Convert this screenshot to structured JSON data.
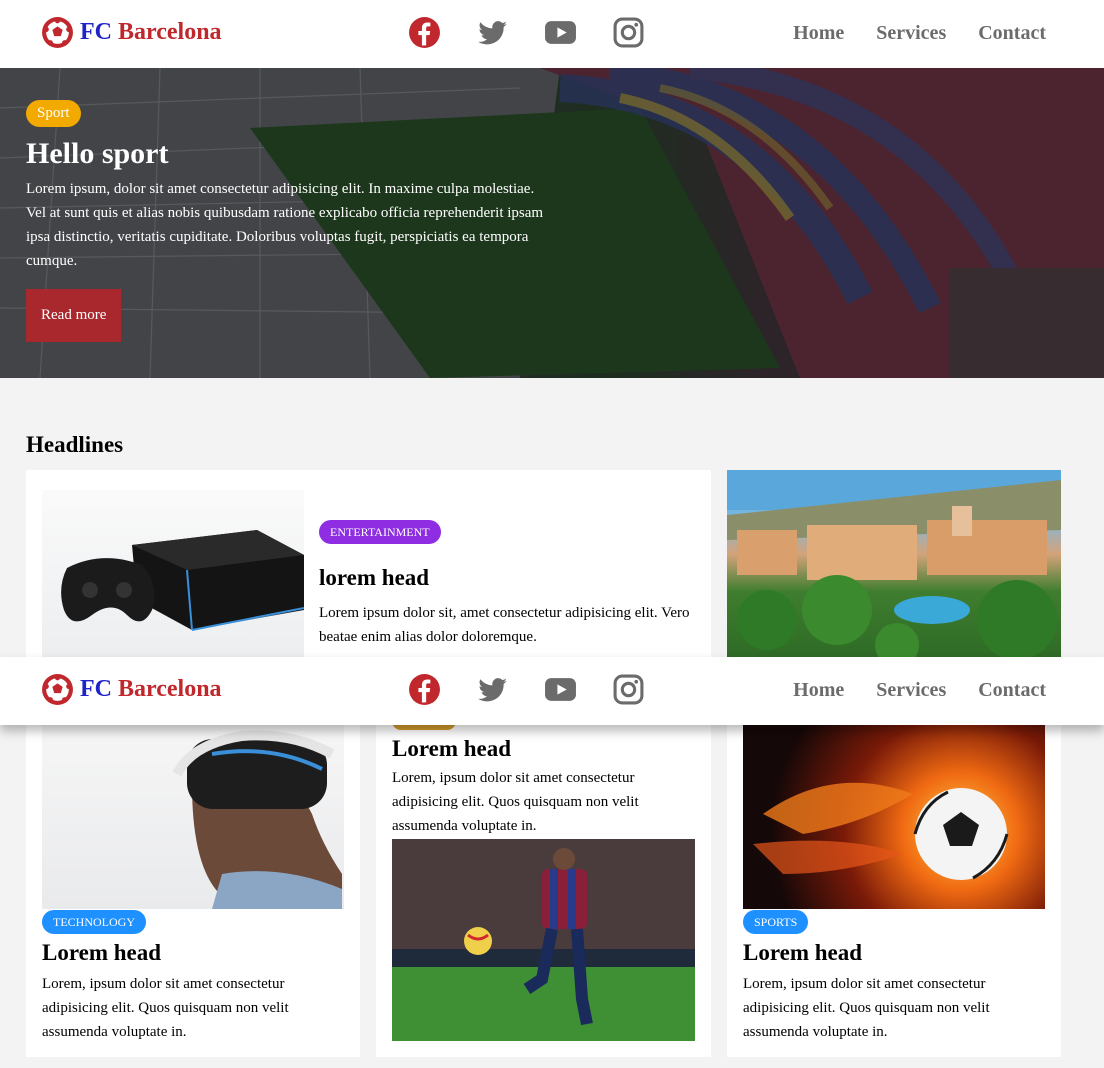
{
  "brand": {
    "fc": "FC",
    "name": "Barcelona"
  },
  "socials": [
    "facebook-icon",
    "twitter-icon",
    "youtube-icon",
    "instagram-icon"
  ],
  "nav": {
    "home": "Home",
    "services": "Services",
    "contact": "Contact"
  },
  "hero": {
    "badge": "Sport",
    "title": "Hello sport",
    "text": "Lorem ipsum, dolor sit amet consectetur adipisicing elit. In maxime culpa molestiae. Vel at sunt quis et alias nobis quibusdam ratione explicabo officia reprehenderit ipsam ipsa distinctio, veritatis cupiditate. Doloribus voluptas fugit, perspiciatis ea tempora cumque.",
    "button": "Read more"
  },
  "headlines": {
    "title": "Headlines",
    "main": {
      "badge": "ENTERTAINMENT",
      "title": "lorem head",
      "text": "Lorem ipsum dolor sit, amet consectetur adipisicing elit. Vero beatae enim alias dolor doloremque."
    },
    "tech": {
      "badge": "TECHNOLOGY",
      "title": "Lorem head",
      "text": "Lorem, ipsum dolor sit amet consectetur adipisicing elit. Quos quisquam non velit assumenda voluptate in."
    },
    "mid": {
      "title": "Lorem head",
      "text": "Lorem, ipsum dolor sit amet consectetur adipisicing elit. Quos quisquam non velit assumenda voluptate in."
    },
    "sports": {
      "badge": "SPORTS",
      "title": "Lorem head",
      "text": "Lorem, ipsum dolor sit amet consectetur adipisicing elit. Quos quisquam non velit assumenda voluptate in."
    }
  },
  "colors": {
    "brand_blue": "#1f23c9",
    "brand_red": "#c0282d",
    "sport_badge": "#f2a900",
    "read_more": "#a8282d",
    "entertainment": "#8e2de2",
    "technology": "#1e90ff",
    "sports": "#1e90ff"
  }
}
